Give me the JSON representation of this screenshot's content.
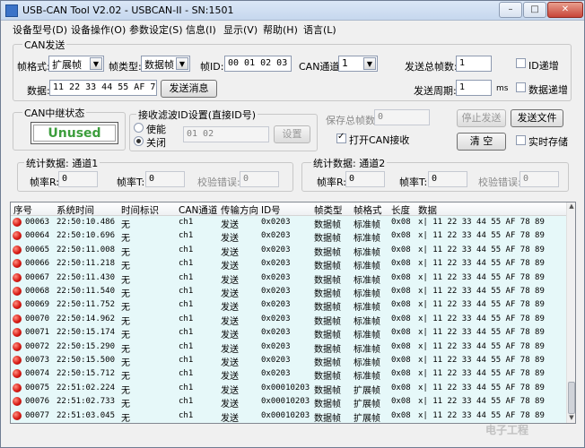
{
  "window": {
    "title": "USB-CAN Tool V2.02 - USBCAN-II - SN:1501",
    "min": "–",
    "max": "□",
    "close": "✕"
  },
  "menu": [
    "设备型号(D)",
    "设备操作(O)",
    "参数设定(S)",
    "信息(I)",
    "显示(V)",
    "帮助(H)",
    "语言(L)"
  ],
  "send": {
    "group_title": "CAN发送",
    "frame_format_label": "帧格式:",
    "frame_format_value": "扩展帧",
    "frame_type_label": "帧类型:",
    "frame_type_value": "数据帧",
    "frame_id_label": "帧ID:",
    "frame_id_value": "00 01 02 03",
    "channel_label": "CAN通道:",
    "channel_value": "1",
    "total_frames_label": "发送总帧数:",
    "total_frames_value": "1",
    "id_increment_label": "ID递增",
    "data_label": "数据:",
    "data_value": "11 22 33 44 55 AF 78 89",
    "send_button": "发送消息",
    "period_label": "发送周期:",
    "period_value": "1",
    "period_unit": "ms",
    "data_increment_label": "数据递增"
  },
  "relay": {
    "group_title": "CAN中继状态",
    "status": "Unused"
  },
  "filter": {
    "group_title": "接收滤波ID设置(直接ID号)",
    "enable_label": "使能",
    "disable_label": "关闭",
    "ids_value": "01 02",
    "set_button": "设置"
  },
  "save": {
    "total_label": "保存总帧数:",
    "total_value": "0",
    "stop_button": "停止发送",
    "send_file_button": "发送文件",
    "open_can_rx_label": "打开CAN接收",
    "clear_button": "清 空",
    "realtime_save_label": "实时存储"
  },
  "stats1": {
    "title": "统计数据: 通道1",
    "rx_label": "帧率R:",
    "rx_value": "0",
    "tx_label": "帧率T:",
    "tx_value": "0",
    "err_label": "校验错误:",
    "err_value": "0"
  },
  "stats2": {
    "title": "统计数据: 通道2",
    "rx_label": "帧率R:",
    "rx_value": "0",
    "tx_label": "帧率T:",
    "tx_value": "0",
    "err_label": "校验错误:",
    "err_value": "0"
  },
  "table": {
    "headers": [
      "序号",
      "系统时间",
      "时间标识",
      "CAN通道",
      "传输方向",
      "ID号",
      "帧类型",
      "帧格式",
      "长度",
      "数据"
    ],
    "rows": [
      [
        "00063",
        "22:50:10.486",
        "无",
        "ch1",
        "发送",
        "0x0203",
        "数据帧",
        "标准帧",
        "0x08",
        "x| 11 22 33 44 55 AF 78 89"
      ],
      [
        "00064",
        "22:50:10.696",
        "无",
        "ch1",
        "发送",
        "0x0203",
        "数据帧",
        "标准帧",
        "0x08",
        "x| 11 22 33 44 55 AF 78 89"
      ],
      [
        "00065",
        "22:50:11.008",
        "无",
        "ch1",
        "发送",
        "0x0203",
        "数据帧",
        "标准帧",
        "0x08",
        "x| 11 22 33 44 55 AF 78 89"
      ],
      [
        "00066",
        "22:50:11.218",
        "无",
        "ch1",
        "发送",
        "0x0203",
        "数据帧",
        "标准帧",
        "0x08",
        "x| 11 22 33 44 55 AF 78 89"
      ],
      [
        "00067",
        "22:50:11.430",
        "无",
        "ch1",
        "发送",
        "0x0203",
        "数据帧",
        "标准帧",
        "0x08",
        "x| 11 22 33 44 55 AF 78 89"
      ],
      [
        "00068",
        "22:50:11.540",
        "无",
        "ch1",
        "发送",
        "0x0203",
        "数据帧",
        "标准帧",
        "0x08",
        "x| 11 22 33 44 55 AF 78 89"
      ],
      [
        "00069",
        "22:50:11.752",
        "无",
        "ch1",
        "发送",
        "0x0203",
        "数据帧",
        "标准帧",
        "0x08",
        "x| 11 22 33 44 55 AF 78 89"
      ],
      [
        "00070",
        "22:50:14.962",
        "无",
        "ch1",
        "发送",
        "0x0203",
        "数据帧",
        "标准帧",
        "0x08",
        "x| 11 22 33 44 55 AF 78 89"
      ],
      [
        "00071",
        "22:50:15.174",
        "无",
        "ch1",
        "发送",
        "0x0203",
        "数据帧",
        "标准帧",
        "0x08",
        "x| 11 22 33 44 55 AF 78 89"
      ],
      [
        "00072",
        "22:50:15.290",
        "无",
        "ch1",
        "发送",
        "0x0203",
        "数据帧",
        "标准帧",
        "0x08",
        "x| 11 22 33 44 55 AF 78 89"
      ],
      [
        "00073",
        "22:50:15.500",
        "无",
        "ch1",
        "发送",
        "0x0203",
        "数据帧",
        "标准帧",
        "0x08",
        "x| 11 22 33 44 55 AF 78 89"
      ],
      [
        "00074",
        "22:50:15.712",
        "无",
        "ch1",
        "发送",
        "0x0203",
        "数据帧",
        "标准帧",
        "0x08",
        "x| 11 22 33 44 55 AF 78 89"
      ],
      [
        "00075",
        "22:51:02.224",
        "无",
        "ch1",
        "发送",
        "0x00010203",
        "数据帧",
        "扩展帧",
        "0x08",
        "x| 11 22 33 44 55 AF 78 89"
      ],
      [
        "00076",
        "22:51:02.733",
        "无",
        "ch1",
        "发送",
        "0x00010203",
        "数据帧",
        "扩展帧",
        "0x08",
        "x| 11 22 33 44 55 AF 78 89"
      ],
      [
        "00077",
        "22:51:03.045",
        "无",
        "ch1",
        "发送",
        "0x00010203",
        "数据帧",
        "扩展帧",
        "0x08",
        "x| 11 22 33 44 55 AF 78 89"
      ]
    ]
  },
  "watermark": "电子工程"
}
